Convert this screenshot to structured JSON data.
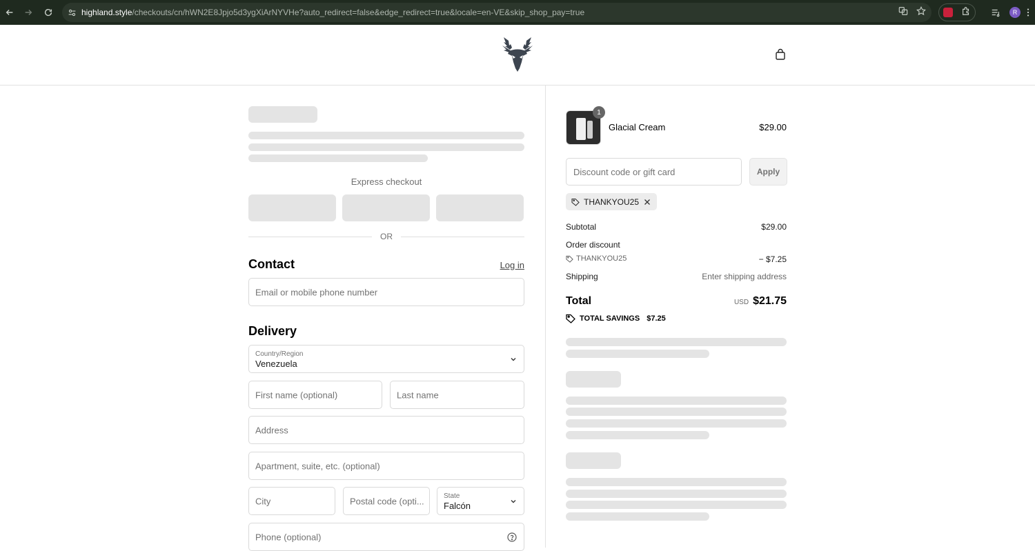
{
  "browser": {
    "url_host": "highland.style",
    "url_path": "/checkouts/cn/hWN2E8Jpjo5d3ygXiArNYVHe?auto_redirect=false&edge_redirect=true&locale=en-VE&skip_shop_pay=true",
    "profile_initial": "R"
  },
  "header": {
    "logo_icon": "deer-head-icon",
    "cart_icon": "shopping-bag-icon"
  },
  "express": {
    "label": "Express checkout",
    "or_label": "OR"
  },
  "contact": {
    "title": "Contact",
    "login_label": "Log in",
    "email_placeholder": "Email or mobile phone number"
  },
  "delivery": {
    "title": "Delivery",
    "country_label": "Country/Region",
    "country_value": "Venezuela",
    "first_name_placeholder": "First name (optional)",
    "last_name_placeholder": "Last name",
    "address_placeholder": "Address",
    "apartment_placeholder": "Apartment, suite, etc. (optional)",
    "city_placeholder": "City",
    "postal_placeholder": "Postal code (opti...",
    "state_label": "State",
    "state_value": "Falcón",
    "phone_placeholder": "Phone (optional)"
  },
  "summary": {
    "product": {
      "name": "Glacial Cream",
      "price": "$29.00",
      "quantity": "1"
    },
    "discount_placeholder": "Discount code or gift card",
    "apply_label": "Apply",
    "applied_code": "THANKYOU25",
    "subtotal_label": "Subtotal",
    "subtotal_value": "$29.00",
    "order_discount_label": "Order discount",
    "discount_code": "THANKYOU25",
    "discount_value": "− $7.25",
    "shipping_label": "Shipping",
    "shipping_value": "Enter shipping address",
    "total_label": "Total",
    "total_currency": "USD",
    "total_value": "$21.75",
    "savings_label": "TOTAL SAVINGS",
    "savings_value": "$7.25"
  },
  "colors": {
    "chrome_bg": "#1f2a1f",
    "skeleton": "#e4e4e4",
    "border": "#d9d9d9"
  }
}
